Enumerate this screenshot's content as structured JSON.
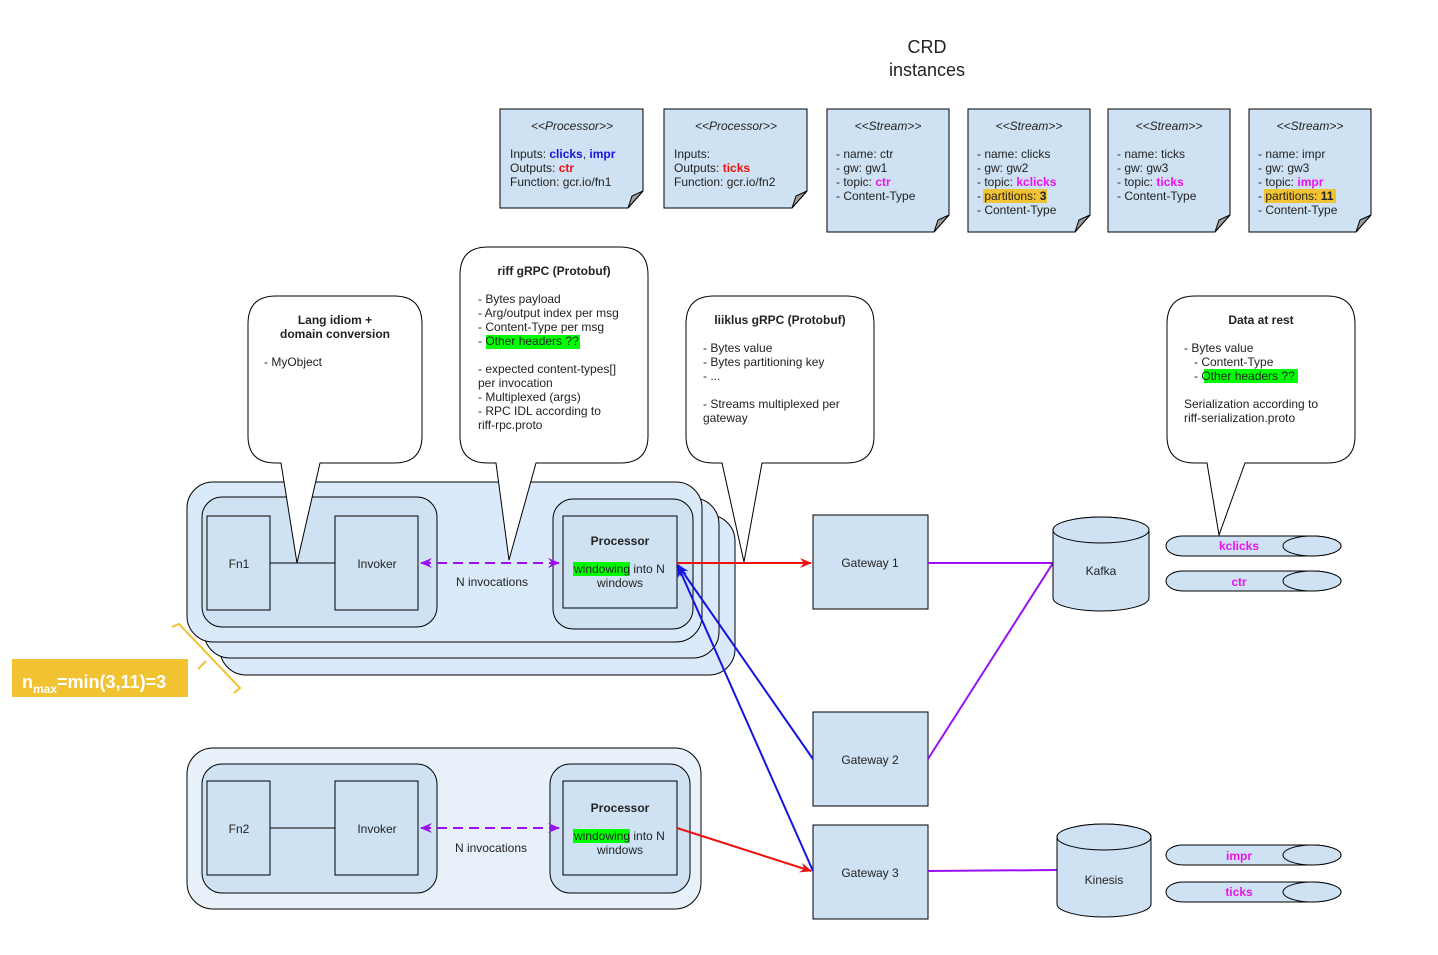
{
  "title": {
    "line1": "CRD",
    "line2": "instances"
  },
  "crd_notes": [
    {
      "stereotype": "<<Processor>>",
      "lines": [
        {
          "label": "Inputs: ",
          "values": [
            {
              "text": "clicks",
              "color": "blue"
            },
            {
              "text": ", ",
              "color": "plain"
            },
            {
              "text": "impr",
              "color": "blue"
            }
          ]
        },
        {
          "label": "Outputs: ",
          "values": [
            {
              "text": "ctr",
              "color": "red"
            }
          ]
        },
        {
          "label": "Function: gcr.io/fn1",
          "values": []
        }
      ]
    },
    {
      "stereotype": "<<Processor>>",
      "lines": [
        {
          "label": "Inputs:",
          "values": []
        },
        {
          "label": "Outputs: ",
          "values": [
            {
              "text": "ticks",
              "color": "red"
            }
          ]
        },
        {
          "label": "Function: gcr.io/fn2",
          "values": []
        }
      ]
    },
    {
      "stereotype": "<<Stream>>",
      "name": "- name: ctr",
      "gw": "- gw: gw1",
      "topic_label": "- topic: ",
      "topic": "ctr",
      "partitions": null,
      "content_type": "- Content-Type"
    },
    {
      "stereotype": "<<Stream>>",
      "name": "- name: clicks",
      "gw": "- gw: gw2",
      "topic_label": "- topic: ",
      "topic": "kclicks",
      "partitions": {
        "label": "partitions: ",
        "value": "3"
      },
      "content_type": "- Content-Type"
    },
    {
      "stereotype": "<<Stream>>",
      "name": "- name: ticks",
      "gw": "- gw: gw3",
      "topic_label": "- topic: ",
      "topic": "ticks",
      "partitions": null,
      "content_type": "- Content-Type"
    },
    {
      "stereotype": "<<Stream>>",
      "name": "- name: impr",
      "gw": "- gw: gw3",
      "topic_label": "- topic: ",
      "topic": "impr",
      "partitions": {
        "label": "partitions: ",
        "value": "11"
      },
      "content_type": "- Content-Type"
    }
  ],
  "bubbles": {
    "lang": {
      "title1": "Lang idiom +",
      "title2": "domain conversion",
      "lines": [
        "- MyObject"
      ]
    },
    "riff": {
      "title": "riff gRPC (Protobuf)",
      "lines": [
        "- Bytes payload",
        "- Arg/output index per msg",
        "- Content-Type per msg"
      ],
      "highlight_prefix": "- ",
      "highlight": "Other headers ??",
      "lines2": [
        "- expected content-types[]",
        "per invocation",
        "- Multiplexed (args)",
        "- RPC IDL according to",
        "riff-rpc.proto"
      ]
    },
    "liiklus": {
      "title": "liiklus gRPC (Protobuf)",
      "lines": [
        "- Bytes value",
        "- Bytes partitioning key",
        "- ..."
      ],
      "lines2": [
        "- Streams multiplexed per",
        "gateway"
      ]
    },
    "rest": {
      "title": "Data at rest",
      "lines": [
        "- Bytes value",
        "   - Content-Type"
      ],
      "highlight_prefix": "   - ",
      "highlight": "Other headers ??",
      "lines2": [
        "Serialization according to",
        "riff-serialization.proto"
      ]
    }
  },
  "pods": [
    {
      "fn": "Fn1",
      "invoker": "Invoker",
      "invocations": "N invocations",
      "processor": "Processor",
      "windowing_hl": "windowing",
      "windowing_rest": " into N",
      "windows": "windows"
    },
    {
      "fn": "Fn2",
      "invoker": "Invoker",
      "invocations": "N invocations",
      "processor": "Processor",
      "windowing_hl": "windowing",
      "windowing_rest": " into N",
      "windows": "windows"
    }
  ],
  "nmax": {
    "n": "n",
    "sub": "max",
    "expr": "=min(3,11)=3"
  },
  "gateways": [
    "Gateway 1",
    "Gateway 2",
    "Gateway 3"
  ],
  "brokers": [
    "Kafka",
    "Kinesis"
  ],
  "topics": {
    "kafka": [
      "kclicks",
      "ctr"
    ],
    "kinesis": [
      "impr",
      "ticks"
    ]
  },
  "colors": {
    "output_edge": "#ee1111",
    "input_edge": "#1515e0",
    "broker_edge": "#9911ee",
    "invocation_edge": "#9911ee",
    "topic_text": "#ee11ee",
    "highlight_green": "#00ff00",
    "highlight_orange": "#f1c232"
  }
}
